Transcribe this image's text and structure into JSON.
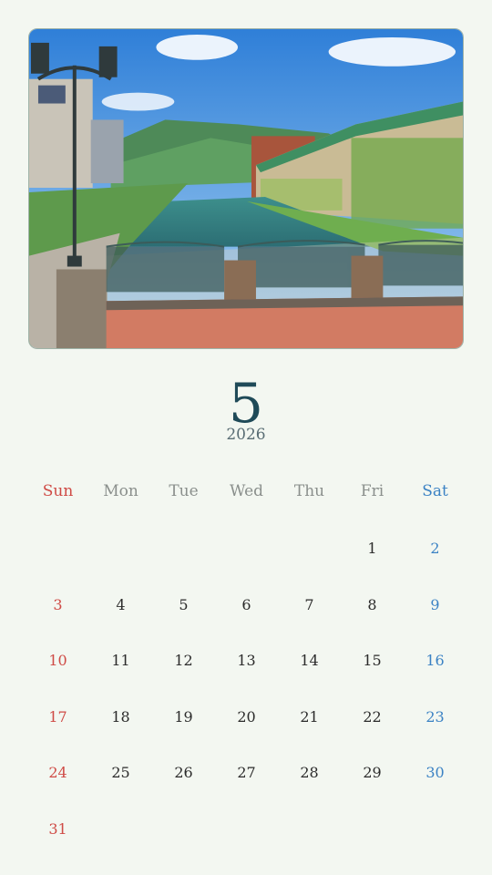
{
  "calendar": {
    "month": "5",
    "year": "2026",
    "weekdays": [
      "Sun",
      "Mon",
      "Tue",
      "Wed",
      "Thu",
      "Fri",
      "Sat"
    ],
    "weeks": [
      [
        "",
        "",
        "",
        "",
        "",
        "1",
        "2"
      ],
      [
        "3",
        "4",
        "5",
        "6",
        "7",
        "8",
        "9"
      ],
      [
        "10",
        "11",
        "12",
        "13",
        "14",
        "15",
        "16"
      ],
      [
        "17",
        "18",
        "19",
        "20",
        "21",
        "22",
        "23"
      ],
      [
        "24",
        "25",
        "26",
        "27",
        "28",
        "29",
        "30"
      ],
      [
        "31",
        "",
        "",
        "",
        "",
        "",
        ""
      ]
    ]
  },
  "colors": {
    "background": "#f3f7f1",
    "month_text": "#1f4a58",
    "sunday": "#cf4b46",
    "saturday": "#3b82c4"
  }
}
